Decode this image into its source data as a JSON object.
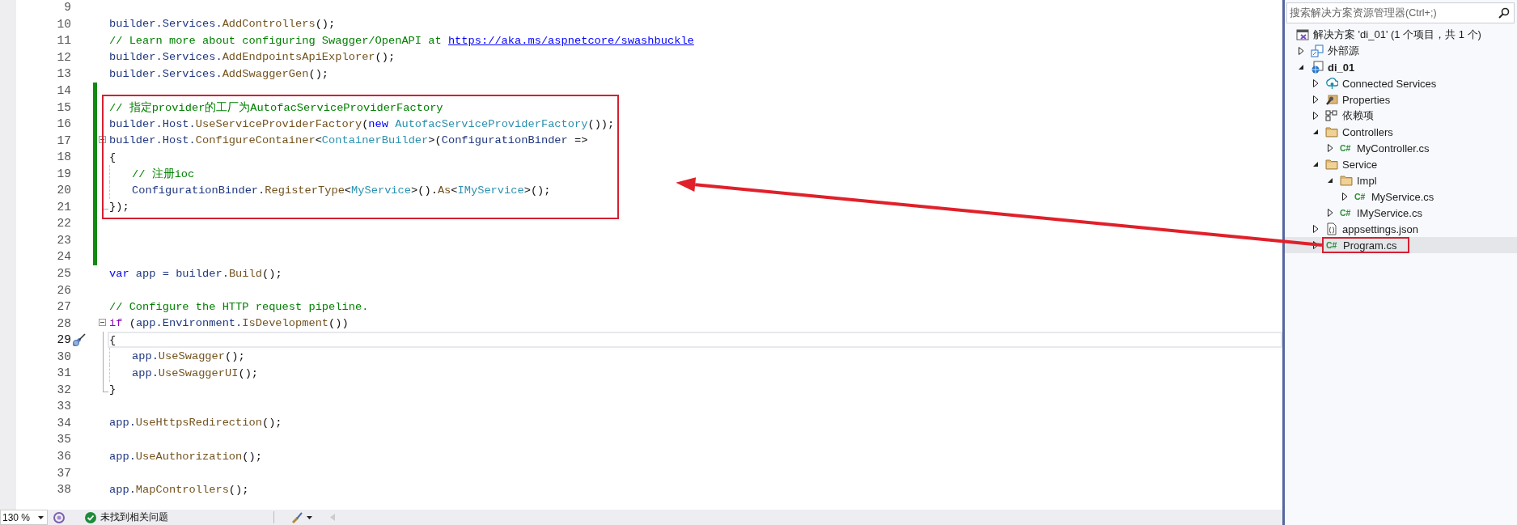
{
  "editor": {
    "lines": [
      {
        "number": "9",
        "kind": "plain",
        "changed": false,
        "boxed": false,
        "current": false,
        "indented": false
      },
      {
        "number": "10",
        "kind": "plain",
        "changed": false,
        "boxed": false,
        "current": false,
        "indented": false,
        "tokens": [
          {
            "text": "builder.Services.",
            "kind": "id"
          },
          {
            "text": "AddControllers",
            "kind": "method"
          },
          {
            "text": "();",
            "kind": "punct"
          }
        ]
      },
      {
        "number": "11",
        "kind": "plain",
        "changed": false,
        "boxed": false,
        "current": false,
        "indented": false,
        "tokens": [
          {
            "text": "// Learn more about configuring Swagger/OpenAPI at ",
            "kind": "comment"
          },
          {
            "text": "https://aka.ms/aspnetcore/swashbuckle",
            "kind": "link"
          }
        ]
      },
      {
        "number": "12",
        "kind": "plain",
        "changed": false,
        "boxed": false,
        "current": false,
        "indented": false,
        "tokens": [
          {
            "text": "builder.Services.",
            "kind": "id"
          },
          {
            "text": "AddEndpointsApiExplorer",
            "kind": "method"
          },
          {
            "text": "();",
            "kind": "punct"
          }
        ]
      },
      {
        "number": "13",
        "kind": "plain",
        "changed": false,
        "boxed": false,
        "current": false,
        "indented": false,
        "tokens": [
          {
            "text": "builder.Services.",
            "kind": "id"
          },
          {
            "text": "AddSwaggerGen",
            "kind": "method"
          },
          {
            "text": "();",
            "kind": "punct"
          }
        ]
      },
      {
        "number": "14",
        "kind": "plain",
        "changed": true,
        "boxed": false,
        "current": false,
        "indented": false
      },
      {
        "number": "15",
        "kind": "plain",
        "changed": true,
        "boxed": true,
        "current": false,
        "indented": false,
        "tokens": [
          {
            "text": "// 指定provider的工厂为AutofacServiceProviderFactory",
            "kind": "comment"
          }
        ]
      },
      {
        "number": "16",
        "kind": "plain",
        "changed": true,
        "boxed": true,
        "current": false,
        "indented": false,
        "tokens": [
          {
            "text": "builder.Host.",
            "kind": "id"
          },
          {
            "text": "UseServiceProviderFactory",
            "kind": "method"
          },
          {
            "text": "(",
            "kind": "punct"
          },
          {
            "text": "new",
            "kind": "keyword"
          },
          {
            "text": " AutofacServiceProviderFactory",
            "kind": "type"
          },
          {
            "text": "());",
            "kind": "punct"
          }
        ]
      },
      {
        "number": "17",
        "kind": "fold-start",
        "changed": true,
        "boxed": true,
        "current": false,
        "indented": false,
        "tokens": [
          {
            "text": "builder.Host.",
            "kind": "id"
          },
          {
            "text": "ConfigureContainer",
            "kind": "method"
          },
          {
            "text": "<",
            "kind": "punct"
          },
          {
            "text": "ContainerBuilder",
            "kind": "type"
          },
          {
            "text": ">(",
            "kind": "punct"
          },
          {
            "text": "ConfigurationBinder",
            "kind": "id"
          },
          {
            "text": " =>",
            "kind": "punct"
          }
        ]
      },
      {
        "number": "18",
        "kind": "fold-inside",
        "changed": true,
        "boxed": true,
        "current": false,
        "indented": false,
        "tokens": [
          {
            "text": "{",
            "kind": "punct"
          }
        ]
      },
      {
        "number": "19",
        "kind": "fold-inside",
        "changed": true,
        "boxed": true,
        "current": false,
        "indented": true,
        "tokens": [
          {
            "text": "// 注册ioc",
            "kind": "comment"
          }
        ]
      },
      {
        "number": "20",
        "kind": "fold-inside",
        "changed": true,
        "boxed": true,
        "current": false,
        "indented": true,
        "tokens": [
          {
            "text": "ConfigurationBinder.",
            "kind": "id"
          },
          {
            "text": "RegisterType",
            "kind": "method"
          },
          {
            "text": "<",
            "kind": "punct"
          },
          {
            "text": "MyService",
            "kind": "type"
          },
          {
            "text": ">().",
            "kind": "punct"
          },
          {
            "text": "As",
            "kind": "method"
          },
          {
            "text": "<",
            "kind": "punct"
          },
          {
            "text": "IMyService",
            "kind": "type"
          },
          {
            "text": ">();",
            "kind": "punct"
          }
        ]
      },
      {
        "number": "21",
        "kind": "fold-end",
        "changed": true,
        "boxed": true,
        "current": false,
        "indented": false,
        "tokens": [
          {
            "text": "});",
            "kind": "punct"
          }
        ]
      },
      {
        "number": "22",
        "kind": "plain",
        "changed": true,
        "boxed": false,
        "current": false,
        "indented": false
      },
      {
        "number": "23",
        "kind": "plain",
        "changed": true,
        "boxed": false,
        "current": false,
        "indented": false
      },
      {
        "number": "24",
        "kind": "plain",
        "changed": true,
        "boxed": false,
        "current": false,
        "indented": false
      },
      {
        "number": "25",
        "kind": "plain",
        "changed": false,
        "boxed": false,
        "current": false,
        "indented": false,
        "tokens": [
          {
            "text": "var",
            "kind": "keyword"
          },
          {
            "text": " app = builder.",
            "kind": "id"
          },
          {
            "text": "Build",
            "kind": "method"
          },
          {
            "text": "();",
            "kind": "punct"
          }
        ]
      },
      {
        "number": "26",
        "kind": "plain",
        "changed": false,
        "boxed": false,
        "current": false,
        "indented": false
      },
      {
        "number": "27",
        "kind": "plain",
        "changed": false,
        "boxed": false,
        "current": false,
        "indented": false,
        "tokens": [
          {
            "text": "// Configure the HTTP request pipeline.",
            "kind": "comment"
          }
        ]
      },
      {
        "number": "28",
        "kind": "fold-start",
        "changed": false,
        "boxed": false,
        "current": false,
        "indented": false,
        "tokens": [
          {
            "text": "if",
            "kind": "control"
          },
          {
            "text": " (",
            "kind": "punct"
          },
          {
            "text": "app.Environment.",
            "kind": "id"
          },
          {
            "text": "IsDevelopment",
            "kind": "method"
          },
          {
            "text": "())",
            "kind": "punct"
          }
        ]
      },
      {
        "number": "29",
        "kind": "fold-inside",
        "changed": false,
        "boxed": false,
        "current": true,
        "indented": false,
        "tokens": [
          {
            "text": "{",
            "kind": "punct"
          }
        ]
      },
      {
        "number": "30",
        "kind": "fold-inside",
        "changed": false,
        "boxed": false,
        "current": false,
        "indented": true,
        "tokens": [
          {
            "text": "app.",
            "kind": "id"
          },
          {
            "text": "UseSwagger",
            "kind": "method"
          },
          {
            "text": "();",
            "kind": "punct"
          }
        ]
      },
      {
        "number": "31",
        "kind": "fold-inside",
        "changed": false,
        "boxed": false,
        "current": false,
        "indented": true,
        "tokens": [
          {
            "text": "app.",
            "kind": "id"
          },
          {
            "text": "UseSwaggerUI",
            "kind": "method"
          },
          {
            "text": "();",
            "kind": "punct"
          }
        ]
      },
      {
        "number": "32",
        "kind": "fold-end",
        "changed": false,
        "boxed": false,
        "current": false,
        "indented": false,
        "tokens": [
          {
            "text": "}",
            "kind": "punct"
          }
        ]
      },
      {
        "number": "33",
        "kind": "plain",
        "changed": false,
        "boxed": false,
        "current": false,
        "indented": false
      },
      {
        "number": "34",
        "kind": "plain",
        "changed": false,
        "boxed": false,
        "current": false,
        "indented": false,
        "tokens": [
          {
            "text": "app.",
            "kind": "id"
          },
          {
            "text": "UseHttpsRedirection",
            "kind": "method"
          },
          {
            "text": "();",
            "kind": "punct"
          }
        ]
      },
      {
        "number": "35",
        "kind": "plain",
        "changed": false,
        "boxed": false,
        "current": false,
        "indented": false
      },
      {
        "number": "36",
        "kind": "plain",
        "changed": false,
        "boxed": false,
        "current": false,
        "indented": false,
        "tokens": [
          {
            "text": "app.",
            "kind": "id"
          },
          {
            "text": "UseAuthorization",
            "kind": "method"
          },
          {
            "text": "();",
            "kind": "punct"
          }
        ]
      },
      {
        "number": "37",
        "kind": "plain",
        "changed": false,
        "boxed": false,
        "current": false,
        "indented": false
      },
      {
        "number": "38",
        "kind": "plain",
        "changed": false,
        "boxed": false,
        "current": false,
        "indented": false,
        "tokens": [
          {
            "text": "app.",
            "kind": "id"
          },
          {
            "text": "MapControllers",
            "kind": "method"
          },
          {
            "text": "();",
            "kind": "punct"
          }
        ]
      }
    ]
  },
  "status_bar": {
    "zoom": "130 %",
    "issues": "未找到相关问题"
  },
  "solution_explorer": {
    "search": {
      "placeholder": "搜索解决方案资源管理器(Ctrl+;)"
    },
    "tree": [
      {
        "label": "解决方案 'di_01' (1 个项目，共 1 个)",
        "kind": "solution",
        "selected": false,
        "annotated": false
      },
      {
        "label": "外部源",
        "kind": "external",
        "expanded": false,
        "selected": false,
        "annotated": false
      },
      {
        "label": "di_01",
        "kind": "project",
        "expanded": true,
        "selected": false,
        "annotated": false,
        "children": [
          {
            "label": "Connected Services",
            "kind": "connected",
            "expanded": false,
            "selected": false,
            "annotated": false
          },
          {
            "label": "Properties",
            "kind": "properties",
            "expanded": false,
            "selected": false,
            "annotated": false
          },
          {
            "label": "依赖项",
            "kind": "dependencies",
            "expanded": false,
            "selected": false,
            "annotated": false
          },
          {
            "label": "Controllers",
            "kind": "folder",
            "expanded": true,
            "selected": false,
            "annotated": false,
            "children": [
              {
                "label": "MyController.cs",
                "kind": "csharp",
                "badge": "C#",
                "expanded": false,
                "selected": false,
                "annotated": false
              }
            ]
          },
          {
            "label": "Service",
            "kind": "folder",
            "expanded": true,
            "selected": false,
            "annotated": false,
            "children": [
              {
                "label": "Impl",
                "kind": "folder",
                "expanded": true,
                "selected": false,
                "annotated": false,
                "children": [
                  {
                    "label": "MyService.cs",
                    "kind": "csharp",
                    "badge": "C#",
                    "expanded": false,
                    "selected": false,
                    "annotated": false
                  }
                ]
              },
              {
                "label": "IMyService.cs",
                "kind": "csharp",
                "badge": "C#",
                "expanded": false,
                "selected": false,
                "annotated": false
              }
            ]
          },
          {
            "label": "appsettings.json",
            "kind": "json",
            "expanded": false,
            "selected": false,
            "annotated": false
          },
          {
            "label": "Program.cs",
            "kind": "csharp",
            "badge": "C#",
            "expanded": false,
            "selected": true,
            "annotated": true
          }
        ]
      }
    ]
  }
}
